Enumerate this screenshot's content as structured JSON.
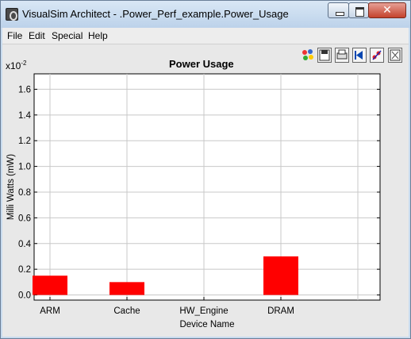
{
  "window": {
    "title": "VisualSim Architect - .Power_Perf_example.Power_Usage",
    "close_glyph": "✕"
  },
  "menu": {
    "items": [
      "File",
      "Edit",
      "Special",
      "Help"
    ]
  },
  "toolbar": {
    "icons": [
      "color-palette-icon",
      "save-icon",
      "print-icon",
      "reset-view-icon",
      "marker-icon",
      "fullscreen-icon"
    ]
  },
  "chart": {
    "multiplier_base": "x10",
    "multiplier_exp": "-2"
  },
  "chart_data": {
    "type": "bar",
    "title": "Power Usage",
    "xlabel": "Device Name",
    "ylabel": "Milli Watts (mW)",
    "categories": [
      "ARM",
      "Cache",
      "HW_Engine",
      "DRAM"
    ],
    "values": [
      0.15,
      0.1,
      0.0,
      0.3
    ],
    "y_ticks": [
      "0.0",
      "0.2",
      "0.4",
      "0.6",
      "0.8",
      "1.0",
      "1.2",
      "1.4",
      "1.6"
    ],
    "ylim": [
      -0.04,
      1.72
    ],
    "grid": true,
    "bar_color": "#ff0000"
  }
}
